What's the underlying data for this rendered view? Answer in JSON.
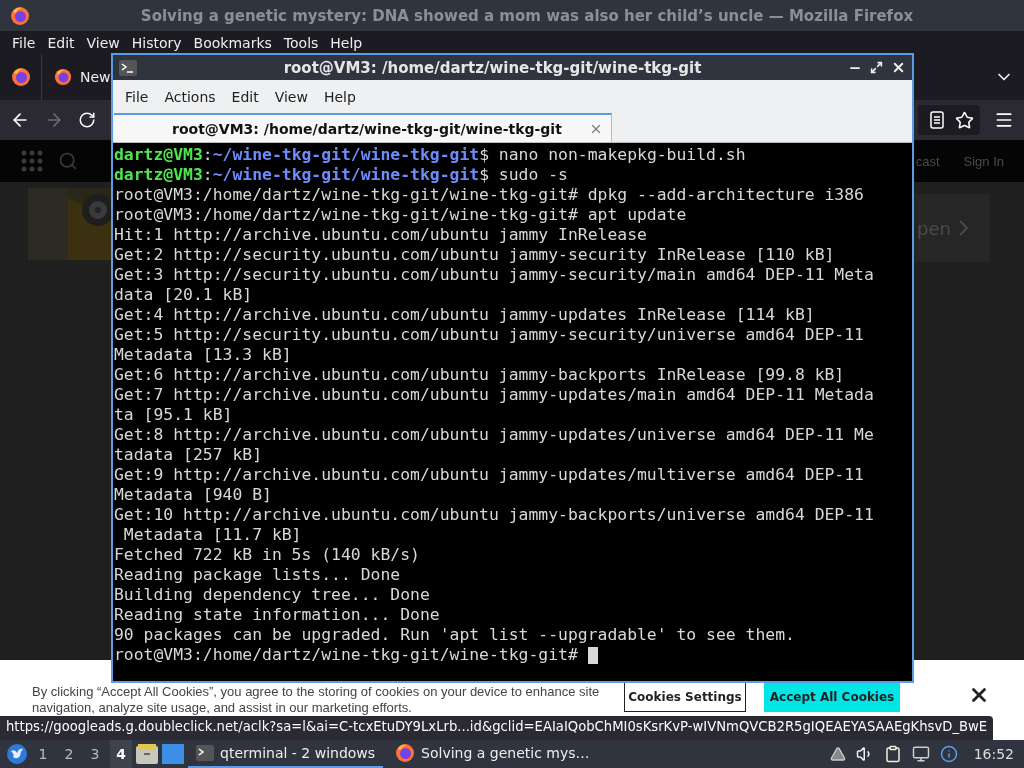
{
  "firefox": {
    "title": "Solving a genetic mystery: DNA showed a mom was also her child’s uncle — Mozilla Firefox",
    "menu": [
      "File",
      "Edit",
      "View",
      "History",
      "Bookmarks",
      "Tools",
      "Help"
    ],
    "tab": {
      "label": "New"
    },
    "nav": {
      "forward_disabled": true
    },
    "page": {
      "header_links": [
        "cast",
        "Sign In"
      ],
      "promo_text": "pen"
    },
    "cookie_banner": {
      "text": "By clicking “Accept All Cookies”, you agree to the storing of cookies on your device to enhance site navigation, analyze site usage, and assist in our marketing efforts.",
      "buttons": [
        {
          "label": "Cookies Settings",
          "kind": "outline"
        },
        {
          "label": "Accept All Cookies",
          "kind": "primary"
        }
      ]
    },
    "status_url": "https://googleads.g.doubleclick.net/aclk?sa=l&ai=C-tcxEtuDY9LxLrb...id&gclid=EAIaIQobChMI0sKsrKvP-wIVNmQVCB2R5gIQEAEYASAAEgKhsvD_BwE"
  },
  "terminal": {
    "title": "root@VM3: /home/dartz/wine-tkg-git/wine-tkg-git",
    "menu": [
      "File",
      "Actions",
      "Edit",
      "View",
      "Help"
    ],
    "tab": {
      "label": "root@VM3: /home/dartz/wine-tkg-git/wine-tkg-git"
    },
    "cursor_visible": true,
    "lines": [
      {
        "kind": "user_prompt",
        "user": "dartz@VM3",
        "separator": ":",
        "path": "~/wine-tkg-git/wine-tkg-git",
        "text": "$ nano non-makepkg-build.sh"
      },
      {
        "kind": "user_prompt",
        "user": "dartz@VM3",
        "separator": ":",
        "path": "~/wine-tkg-git/wine-tkg-git",
        "text": "$ sudo -s"
      },
      {
        "kind": "output",
        "text": "root@VM3:/home/dartz/wine-tkg-git/wine-tkg-git# dpkg --add-architecture i386"
      },
      {
        "kind": "output",
        "text": "root@VM3:/home/dartz/wine-tkg-git/wine-tkg-git# apt update"
      },
      {
        "kind": "output",
        "text": "Hit:1 http://archive.ubuntu.com/ubuntu jammy InRelease"
      },
      {
        "kind": "output",
        "text": "Get:2 http://security.ubuntu.com/ubuntu jammy-security InRelease [110 kB]"
      },
      {
        "kind": "output",
        "text": "Get:3 http://security.ubuntu.com/ubuntu jammy-security/main amd64 DEP-11 Meta"
      },
      {
        "kind": "output",
        "text": "data [20.1 kB]"
      },
      {
        "kind": "output",
        "text": "Get:4 http://archive.ubuntu.com/ubuntu jammy-updates InRelease [114 kB]"
      },
      {
        "kind": "output",
        "text": "Get:5 http://security.ubuntu.com/ubuntu jammy-security/universe amd64 DEP-11"
      },
      {
        "kind": "output",
        "text": "Metadata [13.3 kB]"
      },
      {
        "kind": "output",
        "text": "Get:6 http://archive.ubuntu.com/ubuntu jammy-backports InRelease [99.8 kB]"
      },
      {
        "kind": "output",
        "text": "Get:7 http://archive.ubuntu.com/ubuntu jammy-updates/main amd64 DEP-11 Metada"
      },
      {
        "kind": "output",
        "text": "ta [95.1 kB]"
      },
      {
        "kind": "output",
        "text": "Get:8 http://archive.ubuntu.com/ubuntu jammy-updates/universe amd64 DEP-11 Me"
      },
      {
        "kind": "output",
        "text": "tadata [257 kB]"
      },
      {
        "kind": "output",
        "text": "Get:9 http://archive.ubuntu.com/ubuntu jammy-updates/multiverse amd64 DEP-11"
      },
      {
        "kind": "output",
        "text": "Metadata [940 B]"
      },
      {
        "kind": "output",
        "text": "Get:10 http://archive.ubuntu.com/ubuntu jammy-backports/universe amd64 DEP-11"
      },
      {
        "kind": "output",
        "text": " Metadata [11.7 kB]"
      },
      {
        "kind": "output",
        "text": "Fetched 722 kB in 5s (140 kB/s)"
      },
      {
        "kind": "output",
        "text": "Reading package lists... Done"
      },
      {
        "kind": "output",
        "text": "Building dependency tree... Done"
      },
      {
        "kind": "output",
        "text": "Reading state information... Done"
      },
      {
        "kind": "output",
        "text": "90 packages can be upgraded. Run 'apt list --upgradable' to see them."
      },
      {
        "kind": "output",
        "text": "root@VM3:/home/dartz/wine-tkg-git/wine-tkg-git# "
      }
    ]
  },
  "taskbar": {
    "workspaces": [
      {
        "label": "1",
        "selected": false
      },
      {
        "label": "2",
        "selected": false
      },
      {
        "label": "3",
        "selected": false
      },
      {
        "label": "4",
        "selected": true
      }
    ],
    "tasks": [
      {
        "kind": "terminal",
        "label": "qterminal - 2 windows",
        "selected": true
      },
      {
        "kind": "browser",
        "label": "Solving a genetic mys…",
        "selected": false
      }
    ],
    "clock": "16:52"
  }
}
